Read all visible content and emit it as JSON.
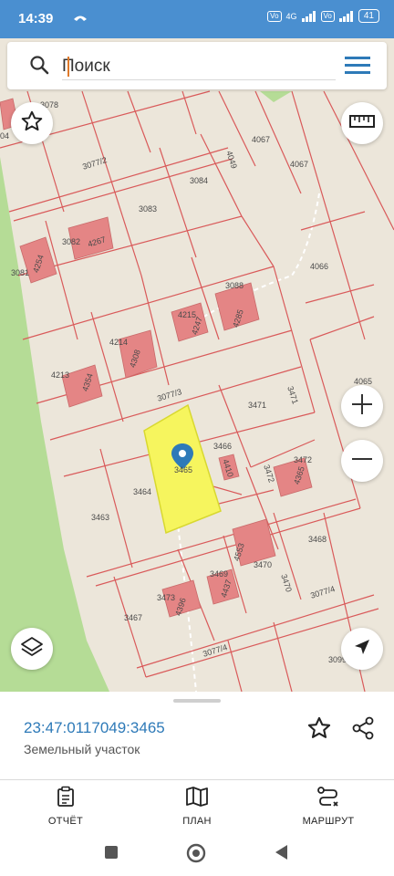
{
  "status_bar": {
    "time": "14:39",
    "left_icon": "missed-call-icon",
    "network_1": "4G",
    "battery": "41"
  },
  "search": {
    "placeholder": "Поиск",
    "icon": "search-icon",
    "menu_icon": "hamburger-menu-icon"
  },
  "map": {
    "parcel_labels": [
      "3078",
      "04",
      "3077/2",
      "4067",
      "4067",
      "3084",
      "4049",
      "3083",
      "3082",
      "4267",
      "3081",
      "4254",
      "4066",
      "3088",
      "4215",
      "4247",
      "4285",
      "4214",
      "4308",
      "4213",
      "4354",
      "3077/3",
      "3471",
      "3471",
      "4065",
      "3466",
      "3465",
      "3464",
      "4410",
      "3472",
      "3472",
      "4365",
      "3463",
      "3468",
      "4553",
      "3469",
      "3470",
      "3470",
      "3473",
      "4396",
      "4437",
      "3077/4",
      "3467",
      "3077/4",
      "3099"
    ],
    "selected_parcel": "3465",
    "highlight_color": "#f6f55e",
    "building_color": "#e48585",
    "boundary_color": "#d95a5a",
    "forest_color": "#b5dc96",
    "background_color": "#ece6da"
  },
  "controls": {
    "favorite_icon": "star-outline-icon",
    "ruler_icon": "ruler-icon",
    "zoom_in_icon": "plus-icon",
    "zoom_out_icon": "minus-icon",
    "layers_icon": "layers-icon",
    "location_icon": "navigation-arrow-icon"
  },
  "sheet": {
    "cadastral_number": "23:47:0117049:3465",
    "object_type": "Земельный участок",
    "accent_color": "#2e7ab8"
  },
  "bottom_nav": {
    "items": [
      {
        "label": "ОТЧЁТ",
        "icon": "report-icon"
      },
      {
        "label": "ПЛАН",
        "icon": "map-plan-icon"
      },
      {
        "label": "МАРШРУТ",
        "icon": "route-icon"
      }
    ]
  }
}
